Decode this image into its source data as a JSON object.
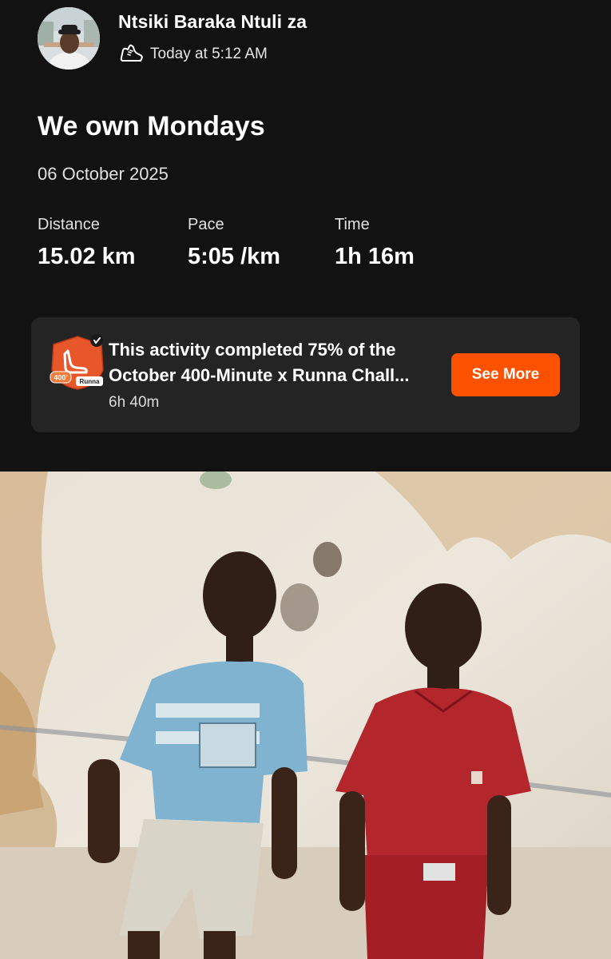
{
  "header": {
    "athlete_name": "Ntsiki Baraka Ntuli za",
    "timestamp": "Today at 5:12 AM",
    "activity_icon": "running-shoe-icon"
  },
  "activity": {
    "title": "We own Mondays",
    "date": "06 October 2025"
  },
  "stats": [
    {
      "label": "Distance",
      "value": "15.02 km"
    },
    {
      "label": "Pace",
      "value": "5:05 /km"
    },
    {
      "label": "Time",
      "value": "1h 16m"
    }
  ],
  "challenge": {
    "line1": "This activity completed 75% of the",
    "line2": "October 400-Minute x Runna Chall...",
    "duration": "6h 40m",
    "button_label": "See More",
    "badge_text": "400'",
    "badge_brand": "Runna",
    "progress_percent": 75
  },
  "colors": {
    "background": "#121212",
    "card": "#242424",
    "accent": "#fc5200",
    "text": "#ffffff"
  }
}
